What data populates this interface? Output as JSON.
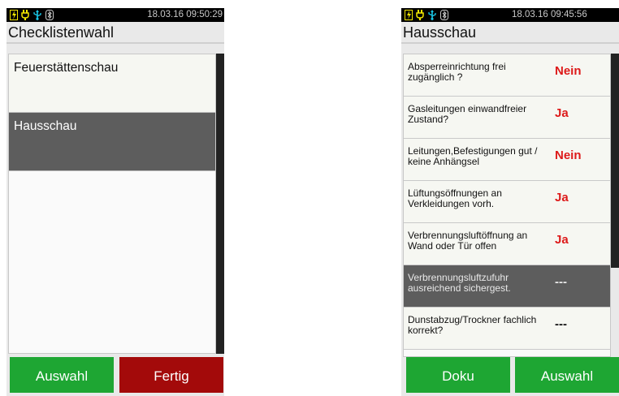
{
  "left_screen": {
    "status": {
      "datetime": "18.03.16 09:50:29"
    },
    "title": "Checklistenwahl",
    "items": [
      {
        "label": "Feuerstättenschau",
        "selected": false
      },
      {
        "label": "Hausschau",
        "selected": true
      }
    ],
    "buttons": {
      "left": "Auswahl",
      "right": "Fertig"
    }
  },
  "right_screen": {
    "status": {
      "datetime": "18.03.16 09:45:56"
    },
    "title": "Hausschau",
    "rows": [
      {
        "question": "Absperreinrichtung frei zugänglich ?",
        "answer": "Nein",
        "selected": false
      },
      {
        "question": "Gasleitungen einwandfreier Zustand?",
        "answer": "Ja",
        "selected": false
      },
      {
        "question": "Leitungen,Befestigungen gut / keine Anhängsel",
        "answer": "Nein",
        "selected": false
      },
      {
        "question": "Lüftungsöffnungen an Verkleidungen vorh.",
        "answer": "Ja",
        "selected": false
      },
      {
        "question": "Verbrennungsluftöffnung an Wand oder Tür offen",
        "answer": "Ja",
        "selected": false
      },
      {
        "question": "Verbrennungsluftzufuhr ausreichend sichergest.",
        "answer": "---",
        "selected": true
      },
      {
        "question": "Dunstabzug/Trockner fachlich korrekt?",
        "answer": "---",
        "selected": false
      }
    ],
    "buttons": {
      "left": "Doku",
      "right": "Auswahl"
    }
  },
  "colors": {
    "button_green": "#1ea633",
    "button_red": "#a30a0a",
    "answer_red": "#dd1a1a",
    "selected_row": "#5d5d5d",
    "status_icon_yellow": "#f2e600",
    "status_icon_cyan": "#19c6e6"
  },
  "status_icons": [
    "battery-charging-icon",
    "power-plug-icon",
    "usb-icon",
    "bluetooth-icon"
  ]
}
